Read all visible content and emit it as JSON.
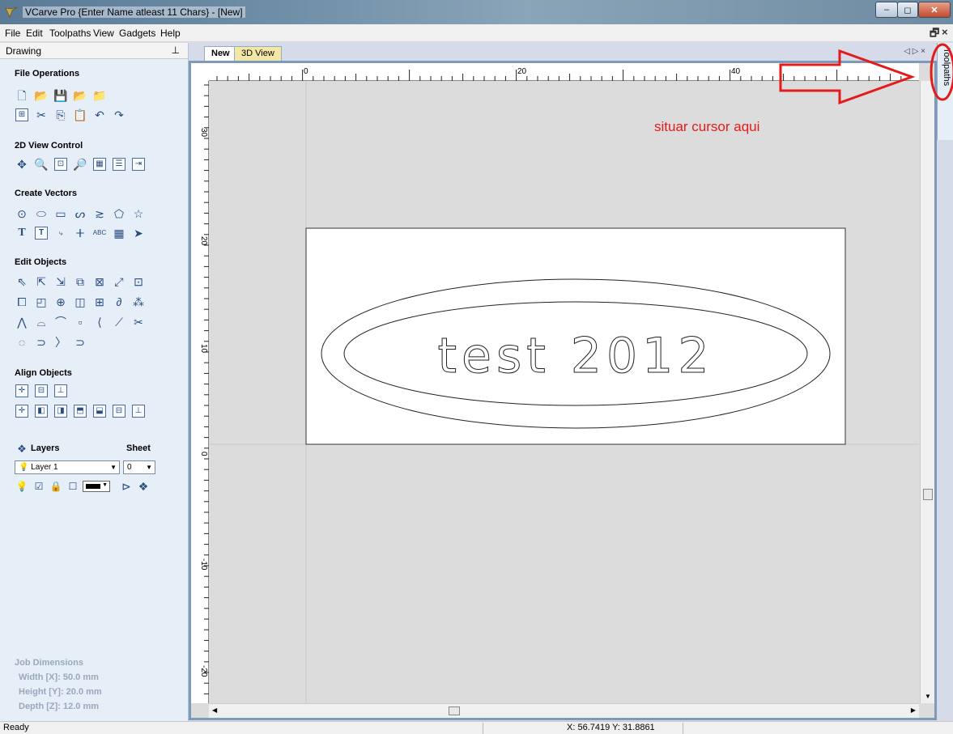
{
  "window": {
    "title": "VCarve Pro {Enter Name atleast 11 Chars} - [New]",
    "controls": {
      "minimize": "–",
      "maximize": "◻",
      "close": "✕"
    }
  },
  "menu": [
    "File",
    "Edit",
    "Toolpaths",
    "View",
    "Gadgets",
    "Help"
  ],
  "mdi_controls": {
    "restore": "🗗",
    "close": "×"
  },
  "panel": {
    "title": "Drawing",
    "pin": "⊥",
    "sections": {
      "file_operations": "File Operations",
      "view_control": "2D View Control",
      "create_vectors": "Create Vectors",
      "edit_objects": "Edit Objects",
      "align_objects": "Align Objects"
    },
    "layers": {
      "title": "Layers",
      "sheet_title": "Sheet",
      "layer_value": "Layer 1",
      "sheet_value": "0"
    },
    "job_dimensions": {
      "title": "Job Dimensions",
      "width": "Width  [X]: 50.0 mm",
      "height": "Height [Y]: 20.0 mm",
      "depth": "Depth  [Z]: 12.0 mm"
    }
  },
  "tabs": [
    {
      "label": "New",
      "active": true
    },
    {
      "label": "3D View",
      "active": false
    }
  ],
  "tab_controls": "◁ ▷ ×",
  "side_tab": "Toolpaths",
  "ruler": {
    "top_labels": [
      "0",
      "20",
      "40"
    ],
    "left_labels": [
      "30",
      "20",
      "10",
      "0",
      "-10",
      "-20"
    ]
  },
  "drawing": {
    "text": "test 2012"
  },
  "annotation": {
    "text": "situar cursor aqui",
    "color": "#e31b1b"
  },
  "status": {
    "left": "Ready",
    "coords": "X: 56.7419 Y: 31.8861"
  },
  "colors": {
    "accent": "#7f9ab8",
    "panel": "#e6eef8",
    "canvas": "#dcdcdc"
  }
}
